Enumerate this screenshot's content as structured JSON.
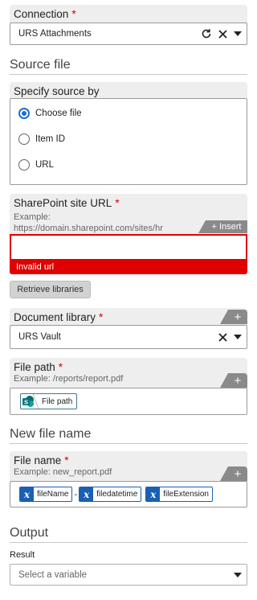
{
  "connection": {
    "label": "Connection",
    "required_mark": "*",
    "value": "URS Attachments"
  },
  "source_file": {
    "heading": "Source file",
    "specify": {
      "label": "Specify source by",
      "options": [
        "Choose file",
        "Item ID",
        "URL"
      ],
      "selected": "Choose file"
    },
    "site_url": {
      "label": "SharePoint site URL",
      "required_mark": "*",
      "example_line1": "Example:",
      "example_line2": "https://domain.sharepoint.com/sites/hr",
      "insert_label": "Insert",
      "value": "",
      "error": "Invalid url"
    },
    "retrieve_label": "Retrieve libraries",
    "library": {
      "label": "Document library",
      "required_mark": "*",
      "value": "URS Vault"
    },
    "file_path": {
      "label": "File path",
      "required_mark": "*",
      "example": "Example: /reports/report.pdf",
      "chip_label": "File path"
    }
  },
  "new_file_name": {
    "heading": "New file name",
    "file_name": {
      "label": "File name",
      "required_mark": "*",
      "example": "Example: new_report.pdf",
      "chips": [
        "fileName",
        "filedatetime",
        "fileExtension"
      ],
      "separator": "-"
    }
  },
  "output": {
    "heading": "Output",
    "result_label": "Result",
    "placeholder": "Select a variable"
  },
  "colors": {
    "accent": "#1a6fd1",
    "error": "#e00000",
    "required": "#d40000",
    "panel": "#eeeeee",
    "tab": "#8a8a8a"
  }
}
